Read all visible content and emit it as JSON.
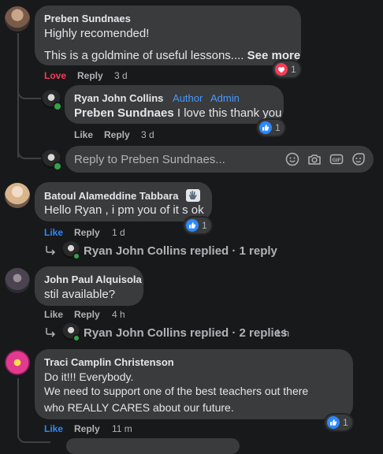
{
  "comments": [
    {
      "author": "Preben Sundnaes",
      "line1": "Highly recomended!",
      "line2": "This is a goldmine of useful lessons....",
      "see_more": "See more",
      "actions": {
        "like": "Love",
        "reply": "Reply",
        "time": "3 d"
      },
      "reaction_count": "1"
    },
    {
      "author": "Batoul Alameddine Tabbara",
      "text": "Hello Ryan , i pm you of it s ok",
      "actions": {
        "like": "Like",
        "reply": "Reply",
        "time": "1 d"
      },
      "reaction_count": "1",
      "replies_summary": "Ryan John Collins replied · 1 reply"
    },
    {
      "author": "John Paul Alquisola",
      "text": "stil available?",
      "actions": {
        "like": "Like",
        "reply": "Reply",
        "time": "4 h"
      },
      "replies_summary": "Ryan John Collins replied · 2 replies",
      "replies_time": "1 h"
    },
    {
      "author": "Traci Camplin Christenson",
      "lines": [
        "Do it!!! Everybody.",
        "We need to support one of the best teachers out there",
        "who REALLY CARES about our future."
      ],
      "actions": {
        "like": "Like",
        "reply": "Reply",
        "time": "11 m"
      },
      "reaction_count": "1"
    }
  ],
  "reply": {
    "author": "Ryan John Collins",
    "badges": [
      "Author",
      "Admin"
    ],
    "mention": "Preben Sundnaes",
    "text": "I love this thank you",
    "actions": {
      "like": "Like",
      "reply": "Reply",
      "time": "3 d"
    },
    "reaction_count": "1"
  },
  "reply_input": {
    "placeholder": "Reply to Preben Sundnaes..."
  },
  "colors": {
    "background": "#18191a",
    "bubble": "#3a3b3c",
    "love": "#f33e58",
    "like": "#2d88ff",
    "online": "#31a24c"
  }
}
